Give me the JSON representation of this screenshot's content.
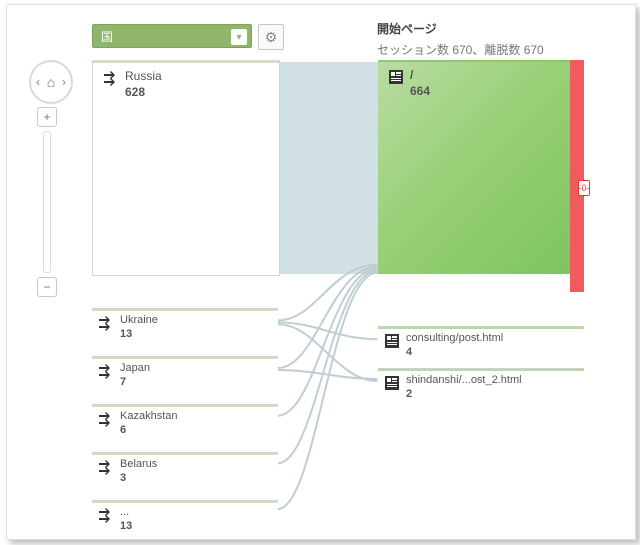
{
  "dimension": {
    "label": "国"
  },
  "right_header": {
    "title": "開始ページ",
    "subtitle": "セッション数 670、離脱数 670"
  },
  "sources": [
    {
      "label": "Russia",
      "value": "628"
    },
    {
      "label": "Ukraine",
      "value": "13"
    },
    {
      "label": "Japan",
      "value": "7"
    },
    {
      "label": "Kazakhstan",
      "value": "6"
    },
    {
      "label": "Belarus",
      "value": "3"
    },
    {
      "label": "...",
      "value": "13"
    }
  ],
  "destinations": [
    {
      "label": "/",
      "value": "664"
    },
    {
      "label": "consulting/post.html",
      "value": "4"
    },
    {
      "label": "shindanshi/...ost_2.html",
      "value": "2"
    }
  ],
  "exit_marker": "-0-",
  "chart_data": {
    "type": "sankey",
    "dimension": "国",
    "target_label": "開始ページ",
    "sessions_total": 670,
    "exits_total": 670,
    "sources": [
      {
        "name": "Russia",
        "value": 628
      },
      {
        "name": "Ukraine",
        "value": 13
      },
      {
        "name": "Japan",
        "value": 7
      },
      {
        "name": "Kazakhstan",
        "value": 6
      },
      {
        "name": "Belarus",
        "value": 3
      },
      {
        "name": "(other)",
        "value": 13
      }
    ],
    "destinations": [
      {
        "name": "/",
        "value": 664
      },
      {
        "name": "consulting/post.html",
        "value": 4
      },
      {
        "name": "shindanshi/...ost_2.html",
        "value": 2
      }
    ]
  }
}
